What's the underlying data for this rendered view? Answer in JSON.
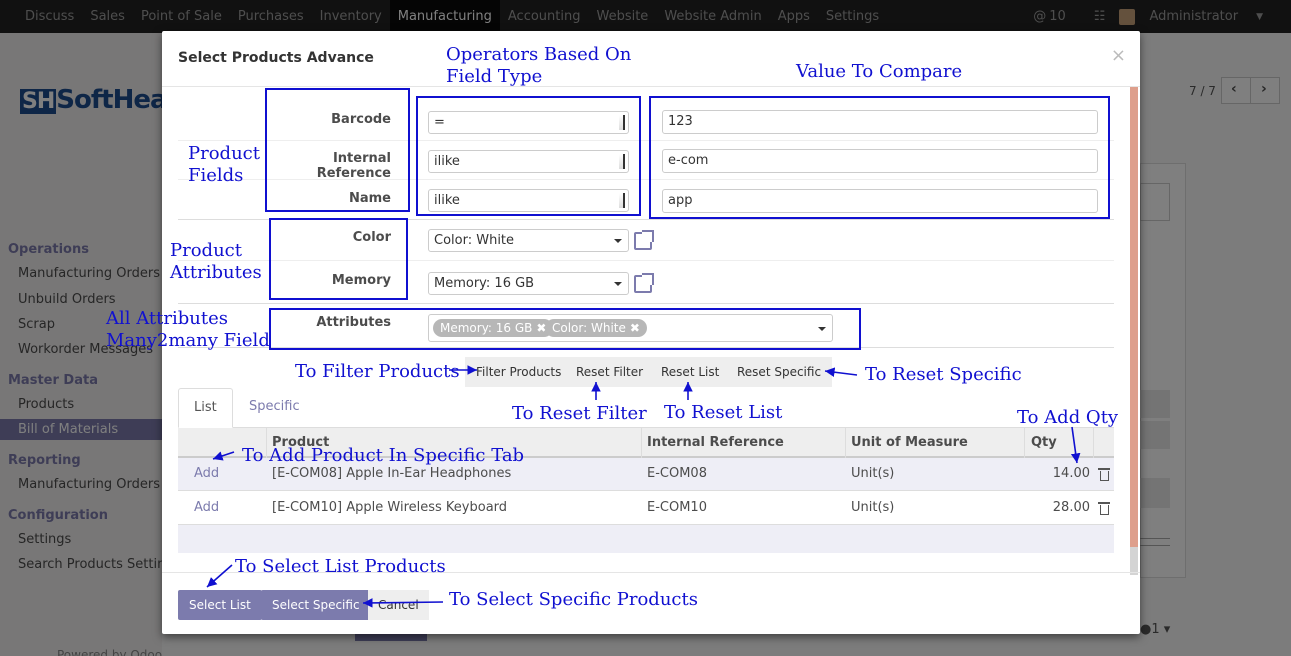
{
  "topbar": {
    "menu": [
      "Discuss",
      "Sales",
      "Point of Sale",
      "Purchases",
      "Inventory",
      "Manufacturing",
      "Accounting",
      "Website",
      "Website Admin",
      "Apps",
      "Settings"
    ],
    "active_index": 5,
    "notif_count": "10",
    "user": "Administrator"
  },
  "sidebar": {
    "logo": "Soft",
    "sections": [
      {
        "title": "Operations",
        "items": [
          "Manufacturing Orders",
          "Unbuild Orders",
          "Scrap",
          "Workorder Messages"
        ]
      },
      {
        "title": "Master Data",
        "items": [
          "Products",
          "Bill of Materials"
        ]
      },
      {
        "title": "Reporting",
        "items": [
          "Manufacturing Orders"
        ]
      },
      {
        "title": "Configuration",
        "items": [
          "Settings",
          "Search Products Settings"
        ]
      }
    ],
    "active_item": "Bill of Materials",
    "powered": "Powered by Odoo"
  },
  "background": {
    "pager": "7 / 7",
    "count": "1"
  },
  "modal": {
    "title": "Select Products Advance",
    "close": "×",
    "fields": [
      {
        "label": "Barcode",
        "operator": "=",
        "value": "123"
      },
      {
        "label": "Internal Reference",
        "operator": "ilike",
        "value": "e-com"
      },
      {
        "label": "Name",
        "operator": "ilike",
        "value": "app"
      }
    ],
    "attributes": [
      {
        "label": "Color",
        "value": "Color: White"
      },
      {
        "label": "Memory",
        "value": "Memory: 16 GB"
      }
    ],
    "attributes_m2m": {
      "label": "Attributes",
      "tags": [
        "Memory: 16 GB",
        "Color: White"
      ]
    },
    "actions": [
      "Filter Products",
      "Reset Filter",
      "Reset List",
      "Reset Specific"
    ],
    "tabs": [
      "List",
      "Specific"
    ],
    "table": {
      "headers": [
        "Product",
        "Internal Reference",
        "Unit of Measure",
        "Qty"
      ],
      "rows": [
        {
          "action": "Add",
          "product": "[E-COM08] Apple In-Ear Headphones",
          "ref": "E-COM08",
          "uom": "Unit(s)",
          "qty": "14.00"
        },
        {
          "action": "Add",
          "product": "[E-COM10] Apple Wireless Keyboard",
          "ref": "E-COM10",
          "uom": "Unit(s)",
          "qty": "28.00"
        }
      ]
    },
    "footer": {
      "select_list": "Select List",
      "select_specific": "Select Specific",
      "cancel": "Cancel"
    }
  },
  "annotations": {
    "operators": "Operators Based On\nField Type",
    "value": "Value To Compare",
    "product_fields": "Product\nFields",
    "product_attributes": "Product\nAttributes",
    "all_attributes": "All Attributes\nMany2many Field",
    "filter": "To Filter Products",
    "reset_specific": "To Reset Specific",
    "reset_filter": "To Reset Filter",
    "reset_list": "To Reset List",
    "add_qty": "To Add Qty",
    "add_product": "To Add Product In Specific Tab",
    "select_list": "To Select List Products",
    "select_specific": "To Select Specific Products"
  },
  "colors": {
    "accent": "#7c7bad",
    "annotation": "#1010d0",
    "topbar": "#232323"
  }
}
